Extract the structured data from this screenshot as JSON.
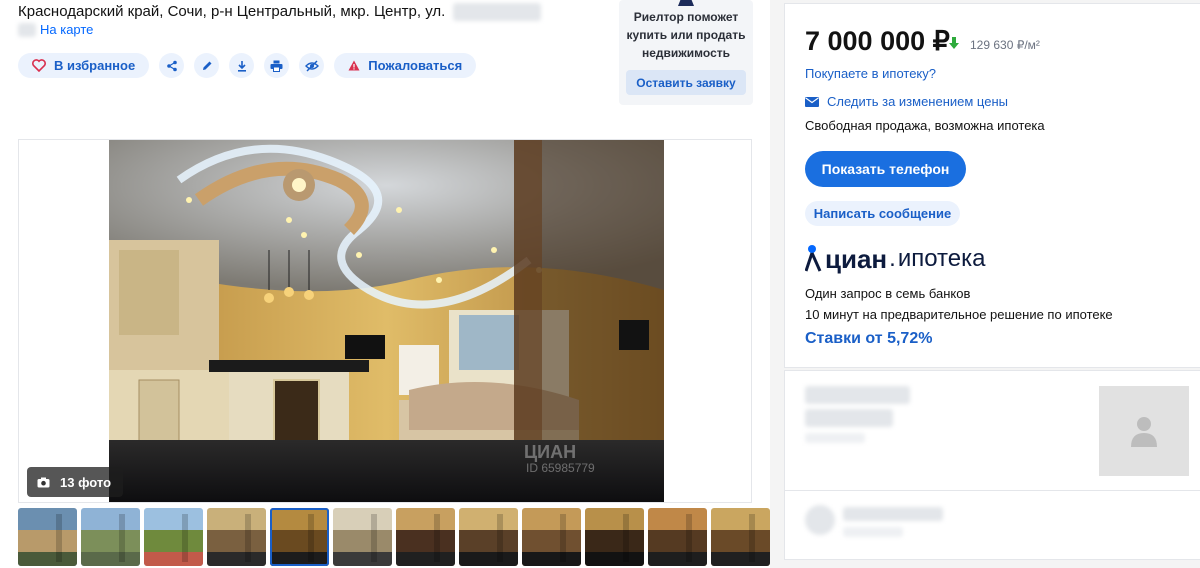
{
  "listing": {
    "address": "Краснодарский край, Сочи, р-н Центральный, мкр. Центр, ул.",
    "map_link": "На карте",
    "actions": {
      "favorite": "В избранное",
      "complain": "Пожаловаться",
      "icons": [
        "heart-icon",
        "share-icon",
        "edit-icon",
        "download-icon",
        "print-icon",
        "hide-icon",
        "warning-icon"
      ]
    }
  },
  "realtor_promo": {
    "text": "Риелтор поможет купить или продать недвижимость",
    "button": "Оставить заявку"
  },
  "gallery": {
    "photo_count": "13 фото",
    "watermark": "ЦИАН",
    "watermark_id": "ID 65985779",
    "thumbnail_count": 12,
    "active_thumbnail": 4
  },
  "offer": {
    "price": "7 000 000 ₽",
    "price_trend": "down",
    "price_per_m2": "129 630 ₽/м²",
    "mortgage_question": "Покупаете в ипотеку?",
    "track_price": "Следить за изменением цены",
    "sale_type": "Свободная продажа, возможна ипотека",
    "show_phone": "Показать телефон",
    "write_message": "Написать сообщение"
  },
  "mortgage": {
    "logo_brand": "циан",
    "logo_product": "ипотека",
    "line1": "Один запрос в семь банков",
    "line2": "10 минут на предварительное решение по ипотеке",
    "rate": "Ставки от 5,72%"
  },
  "colors": {
    "accent": "#1a5fc7",
    "button": "#1a6fe0",
    "pill_bg": "#ebf2fd",
    "trend_down": "#2eaa3c"
  }
}
